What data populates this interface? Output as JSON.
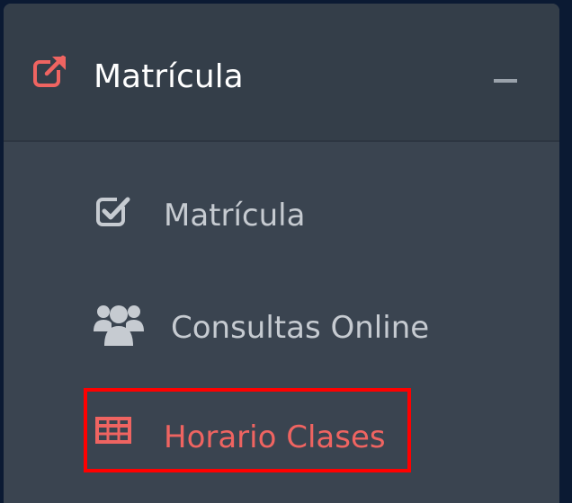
{
  "colors": {
    "background": "#0b1a33",
    "panel": "#3a4450",
    "header": "#343e49",
    "accent": "#ef6461",
    "text_primary": "#ffffff",
    "text_secondary": "#c6cbd1",
    "highlight_border": "#ff0000"
  },
  "menu": {
    "header": {
      "icon": "external-link-icon",
      "label": "Matrícula",
      "toggle": "collapse-minus-icon"
    },
    "items": [
      {
        "icon": "check-square-icon",
        "label": "Matrícula",
        "active": false
      },
      {
        "icon": "users-icon",
        "label": "Consultas Online",
        "active": false
      },
      {
        "icon": "table-icon",
        "label": "Horario Clases",
        "active": true,
        "highlighted": true
      }
    ]
  }
}
